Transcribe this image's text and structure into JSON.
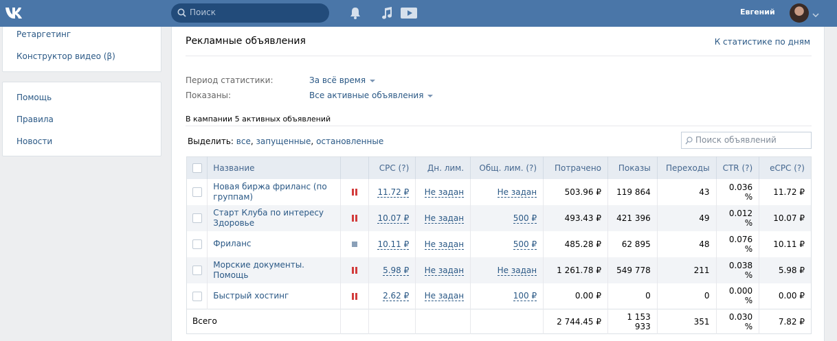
{
  "header": {
    "search_placeholder": "Поиск",
    "user_name": "Евгений",
    "icons": [
      "vk-logo-icon",
      "search-icon",
      "bell-icon",
      "music-icon",
      "video-icon",
      "chevron-down-icon"
    ]
  },
  "sidebar": {
    "group1": [
      {
        "label": "Ретаргетинг"
      },
      {
        "label": "Конструктор видео (β)"
      }
    ],
    "group2": [
      {
        "label": "Помощь"
      },
      {
        "label": "Правила"
      },
      {
        "label": "Новости"
      }
    ]
  },
  "main": {
    "title": "Рекламные объявления",
    "stats_link": "К статистике по дням",
    "period_label": "Период статистики:",
    "period_value": "За всё время",
    "shown_label": "Показаны:",
    "shown_value": "Все активные объявления",
    "count_text": "В кампании 5 активных объявлений",
    "select_prefix": "Выделить:",
    "select_all": "все",
    "select_running": "запущенные",
    "select_stopped": "остановленные",
    "ad_search_placeholder": "Поиск объявлений"
  },
  "table": {
    "columns": [
      "Название",
      "CPC (?)",
      "Дн. лим.",
      "Общ. лим. (?)",
      "Потрачено",
      "Показы",
      "Переходы",
      "CTR (?)",
      "eCPC (?)"
    ],
    "rows": [
      {
        "name": "Новая биржа фриланс (по группам)",
        "status": "paused",
        "cpc": "11.72 ₽",
        "day_limit": "Не задан",
        "total_limit": "Не задан",
        "spent": "503.96 ₽",
        "impressions": "119 864",
        "clicks": "43",
        "ctr": "0.036 %",
        "ecpc": "11.72 ₽"
      },
      {
        "name": "Старт Клуба по интересу Здоровье",
        "status": "paused",
        "cpc": "10.07 ₽",
        "day_limit": "Не задан",
        "total_limit": "500 ₽",
        "spent": "493.43 ₽",
        "impressions": "421 396",
        "clicks": "49",
        "ctr": "0.012 %",
        "ecpc": "10.07 ₽"
      },
      {
        "name": "Фриланс",
        "status": "stopped",
        "cpc": "10.11 ₽",
        "day_limit": "Не задан",
        "total_limit": "500 ₽",
        "spent": "485.28 ₽",
        "impressions": "62 895",
        "clicks": "48",
        "ctr": "0.076 %",
        "ecpc": "10.11 ₽"
      },
      {
        "name": "Морские документы. Помощь",
        "status": "paused",
        "cpc": "5.98 ₽",
        "day_limit": "Не задан",
        "total_limit": "Не задан",
        "spent": "1 261.78 ₽",
        "impressions": "549 778",
        "clicks": "211",
        "ctr": "0.038 %",
        "ecpc": "5.98 ₽"
      },
      {
        "name": "Быстрый хостинг",
        "status": "paused",
        "cpc": "2.62 ₽",
        "day_limit": "Не задан",
        "total_limit": "100 ₽",
        "spent": "0.00 ₽",
        "impressions": "0",
        "clicks": "0",
        "ctr": "0.000 %",
        "ecpc": "0.00 ₽"
      }
    ],
    "total": {
      "label": "Всего",
      "spent": "2 744.45 ₽",
      "impressions": "1 153 933",
      "clicks": "351",
      "ctr": "0.030 %",
      "ecpc": "7.82 ₽"
    }
  },
  "colors": {
    "header_bg": "#4a76a8",
    "link": "#2a5885",
    "pause": "#d23b3b"
  }
}
